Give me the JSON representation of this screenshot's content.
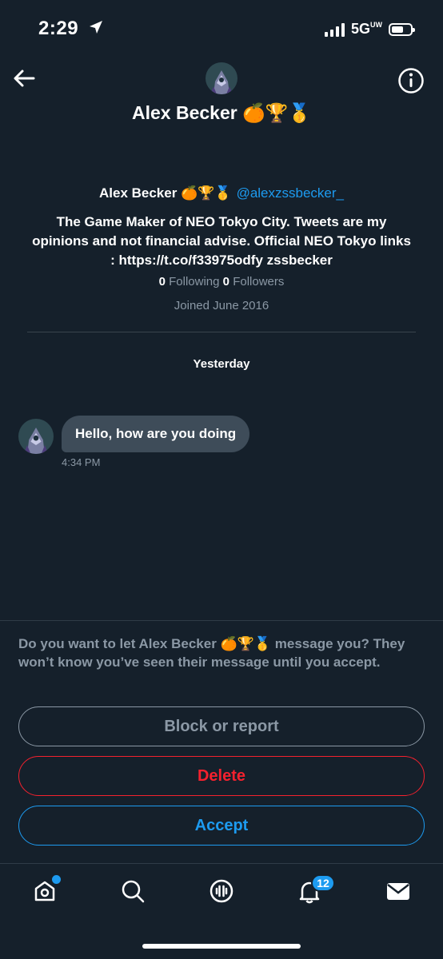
{
  "status_bar": {
    "time": "2:29",
    "network": "5G",
    "network_suffix": "UW"
  },
  "header": {
    "title": "Alex Becker 🍊🏆🥇",
    "back_icon": "back-arrow-icon",
    "info_icon": "info-icon"
  },
  "profile": {
    "name": "Alex Becker 🍊🏆🥇",
    "handle": "@alexzssbecker_",
    "bio": "The Game Maker of NEO Tokyo City. Tweets are my opinions and not financial advise. Official NEO Tokyo links : https://t.co/f33975odfy zssbecker",
    "following_count": "0",
    "following_label": "Following",
    "followers_count": "0",
    "followers_label": "Followers",
    "joined": "Joined June 2016"
  },
  "conversation": {
    "day_label": "Yesterday",
    "messages": [
      {
        "text": "Hello, how are you doing",
        "time": "4:34 PM"
      }
    ]
  },
  "request": {
    "prompt": "Do you want to let Alex Becker 🍊🏆🥇 message you? They won’t know you’ve seen their message until you accept.",
    "block_label": "Block or report",
    "delete_label": "Delete",
    "accept_label": "Accept"
  },
  "tab_bar": {
    "items": [
      "home-icon",
      "search-icon",
      "spaces-icon",
      "notifications-icon",
      "messages-icon"
    ],
    "notifications_badge": "12"
  },
  "colors": {
    "background": "#15202b",
    "accent": "#1d9bf0",
    "danger": "#f4212e",
    "muted": "#8b98a5",
    "bubble": "#3e4c59"
  }
}
